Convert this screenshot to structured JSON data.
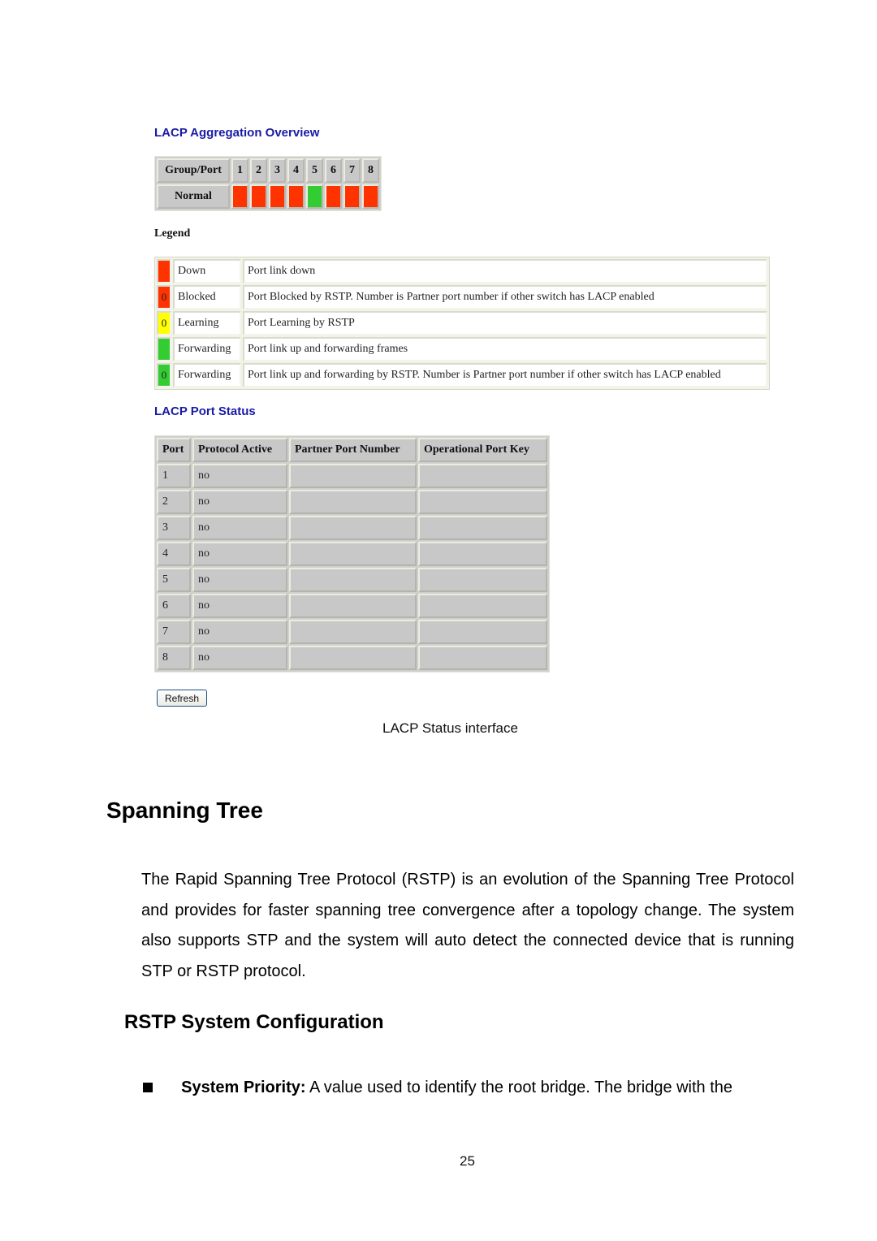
{
  "aggregation": {
    "title": "LACP Aggregation Overview",
    "header_label": "Group/Port",
    "ports": [
      "1",
      "2",
      "3",
      "4",
      "5",
      "6",
      "7",
      "8"
    ],
    "row_label": "Normal",
    "port_states": [
      "down",
      "down",
      "down",
      "down",
      "forwarding",
      "down",
      "down",
      "down"
    ]
  },
  "colors": {
    "down": "#ff3300",
    "blocked": "#ff3300",
    "learning": "#ffff00",
    "forwarding": "#33cc33",
    "title_blue": "#1a1aa6"
  },
  "legend": {
    "label": "Legend",
    "rows": [
      {
        "state": "down",
        "number": "",
        "name": "Down",
        "description": "Port link down"
      },
      {
        "state": "blocked",
        "number": "0",
        "name": "Blocked",
        "description": "Port Blocked by RSTP. Number is Partner port number if other switch has LACP enabled"
      },
      {
        "state": "learning",
        "number": "0",
        "name": "Learning",
        "description": "Port Learning by RSTP"
      },
      {
        "state": "forwarding",
        "number": "",
        "name": "Forwarding",
        "description": "Port link up and forwarding frames"
      },
      {
        "state": "forwarding",
        "number": "0",
        "name": "Forwarding",
        "description": "Port link up and forwarding by RSTP. Number is Partner port number if other switch has LACP enabled"
      }
    ]
  },
  "port_status": {
    "title": "LACP Port Status",
    "columns": [
      "Port",
      "Protocol Active",
      "Partner Port Number",
      "Operational Port Key"
    ],
    "rows": [
      {
        "port": "1",
        "protocol_active": "no",
        "partner_port_number": "",
        "operational_port_key": ""
      },
      {
        "port": "2",
        "protocol_active": "no",
        "partner_port_number": "",
        "operational_port_key": ""
      },
      {
        "port": "3",
        "protocol_active": "no",
        "partner_port_number": "",
        "operational_port_key": ""
      },
      {
        "port": "4",
        "protocol_active": "no",
        "partner_port_number": "",
        "operational_port_key": ""
      },
      {
        "port": "5",
        "protocol_active": "no",
        "partner_port_number": "",
        "operational_port_key": ""
      },
      {
        "port": "6",
        "protocol_active": "no",
        "partner_port_number": "",
        "operational_port_key": ""
      },
      {
        "port": "7",
        "protocol_active": "no",
        "partner_port_number": "",
        "operational_port_key": ""
      },
      {
        "port": "8",
        "protocol_active": "no",
        "partner_port_number": "",
        "operational_port_key": ""
      }
    ],
    "refresh_label": "Refresh"
  },
  "caption": "LACP Status interface",
  "section": {
    "heading": "Spanning Tree",
    "paragraph": "The Rapid Spanning Tree Protocol (RSTP) is an evolution of the Spanning Tree Protocol and provides for faster spanning tree convergence after a topology change. The system also supports STP and the system will auto detect the connected device that is running STP or RSTP protocol.",
    "subheading": "RSTP System Configuration",
    "bullets": [
      {
        "term": "System Priority:",
        "text": " A value used to identify the root bridge. The bridge with the"
      }
    ]
  },
  "page_number": "25"
}
